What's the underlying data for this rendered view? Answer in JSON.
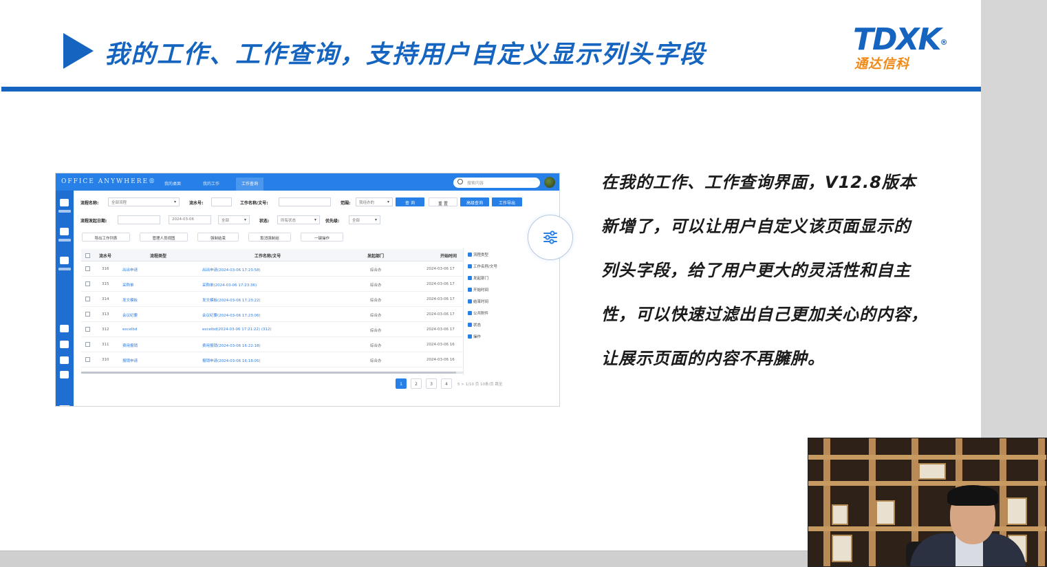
{
  "slide": {
    "title": "我的工作、工作查询，支持用户自定义显示列头字段",
    "logo_text": "TDXK",
    "logo_cn": "通达信科",
    "accent_color": "#1565c0",
    "logo_accent_color": "#f08a18"
  },
  "description": [
    "在我的工作、工作查询界面，V12.8版本",
    "新增了，可以让用户自定义该页面显示的",
    "列头字段，给了用户更大的灵活性和自主",
    "性，可以快速过滤出自己更加关心的内容，",
    "让展示页面的内容不再臃肿。"
  ],
  "app": {
    "brand": "OFFICE ANYWHERE®",
    "tabs": [
      "我的桌面",
      "我的工作",
      "工作查询"
    ],
    "active_tab": 2,
    "search_placeholder": "搜索内容",
    "filters": {
      "flow_name_label": "流程名称:",
      "flow_name_value": "全部流程",
      "flow_no_label": "流水号:",
      "work_name_label": "工作名称/文号:",
      "scope_label": "范围:",
      "scope_value": "我经办的",
      "query_btn": "查 询",
      "reset_btn": "重 置",
      "adv_query_btn": "高级查询",
      "export_btn": "工作导出",
      "start_date_label": "流程发起日期:",
      "start_date_to": "2024-03-06",
      "all_label": "全部",
      "status_label": "状态:",
      "status_value": "所有状态",
      "priority_label": "优先级:",
      "priority_value": "全部"
    },
    "quick_buttons": [
      "导出工作列表",
      "管理人员视图",
      "强制结束",
      "取消强制结",
      "一键操作"
    ],
    "columns": [
      "流水号",
      "流程类型",
      "工作名称/文号",
      "发起部门",
      "开始时间"
    ],
    "rows": [
      {
        "id": "316",
        "type": "出出申请",
        "name": "出出申请(2024-03-06 17:23:58)",
        "dept": "综合办",
        "time": "2024-03-06 17"
      },
      {
        "id": "315",
        "type": "采购单",
        "name": "采购单(2024-03-06 17:23:36)",
        "dept": "综合办",
        "time": "2024-03-06 17"
      },
      {
        "id": "314",
        "type": "发文模板",
        "name": "发文模板(2024-03-06 17:23:22)",
        "dept": "综合办",
        "time": "2024-03-06 17"
      },
      {
        "id": "313",
        "type": "会议纪要",
        "name": "会议纪要(2024-03-06 17:23:06)",
        "dept": "综合办",
        "time": "2024-03-06 17"
      },
      {
        "id": "312",
        "type": "excelbd",
        "name": "excelbd(2024-03-06 17:21:22) (312)",
        "dept": "综合办",
        "time": "2024-03-06 17"
      },
      {
        "id": "311",
        "type": "费用报销",
        "name": "费用报销(2024-03-06 16:22:18)",
        "dept": "综合办",
        "time": "2024-03-06 16"
      },
      {
        "id": "310",
        "type": "报销申请",
        "name": "报销申请(2024-03-06 16:18:05)",
        "dept": "综合办",
        "time": "2024-03-06 16"
      }
    ],
    "column_options": [
      "流程类型",
      "工作名称/文号",
      "发起部门",
      "开始时间",
      "结束时间",
      "公共附件",
      "状态",
      "操作"
    ],
    "pages": [
      "1",
      "2",
      "3",
      "4"
    ],
    "current_page": "1",
    "pager_rest": "5 > 1/10 页  10条/页  跳至",
    "brand_color": "#2680e8"
  }
}
